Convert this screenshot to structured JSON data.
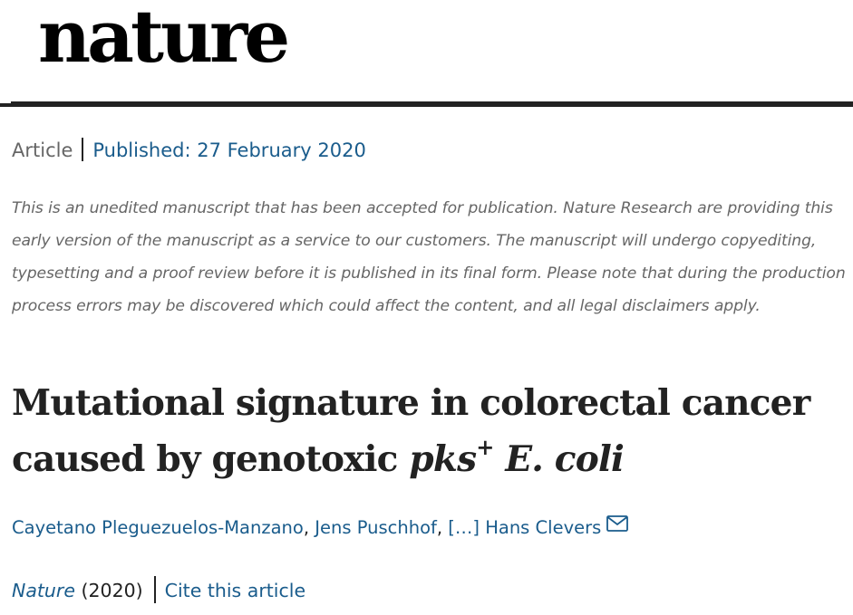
{
  "header": {
    "logo_text": "nature"
  },
  "article": {
    "type": "Article",
    "published": "Published: 27 February 2020",
    "disclaimer": "This is an unedited manuscript that has been accepted for publication. Nature Research are providing this early version of the manuscript as a service to our customers. The manuscript will undergo copyediting, typesetting and a proof review before it is published in its final form. Please note that during the production process errors may be discovered which could affect the content, and all legal disclaimers apply.",
    "title": {
      "line1": "Mutational signature in colorectal cancer",
      "line2_prefix": "caused by genotoxic ",
      "italic_pks": "pks",
      "superscript": "+",
      "italic_species": " E. coli"
    },
    "authors": {
      "first": "Cayetano Pleguezuelos-Manzano",
      "separator1": ", ",
      "second": "Jens Puschhof",
      "separator2": ", ",
      "ellipsis": "[…]",
      "last": " Hans Clevers"
    },
    "citation": {
      "journal": "Nature",
      "year": " (2020)",
      "cite_label": "Cite this article"
    }
  },
  "colors": {
    "link": "#1a5c8c",
    "text": "#222222",
    "muted": "#666666",
    "rule": "#222222"
  },
  "icons": {
    "author_contact": "envelope-icon"
  }
}
